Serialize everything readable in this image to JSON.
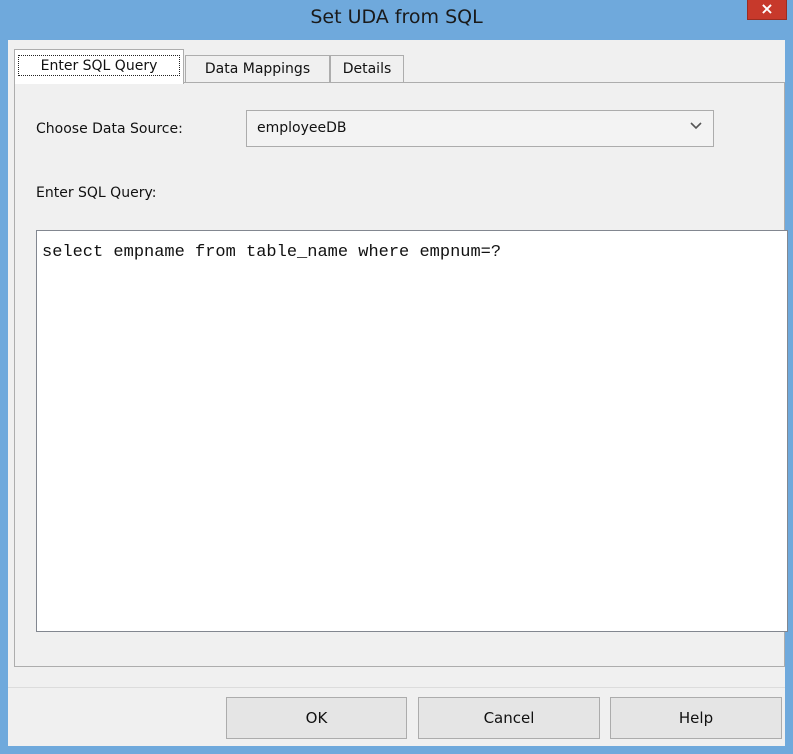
{
  "window": {
    "title": "Set UDA from SQL",
    "close_glyph": "×"
  },
  "tabs": [
    {
      "label": "Enter SQL Query",
      "active": true
    },
    {
      "label": "Data Mappings",
      "active": false
    },
    {
      "label": "Details",
      "active": false
    }
  ],
  "form": {
    "data_source_label": "Choose Data Source:",
    "data_source_value": "employeeDB",
    "dropdown_icon": "chevron-down-icon",
    "sql_label": "Enter SQL Query:",
    "sql_query": "select empname from table_name where empnum=?"
  },
  "buttons": {
    "ok": "OK",
    "cancel": "Cancel",
    "help": "Help"
  },
  "colors": {
    "title_bar": "#6fa9dc",
    "close_button": "#c7392b"
  }
}
